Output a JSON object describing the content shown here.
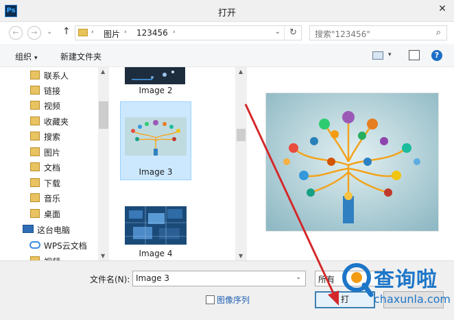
{
  "window": {
    "app_icon_label": "Ps",
    "title": "打开",
    "close_glyph": "✕"
  },
  "navigation": {
    "back_glyph": "←",
    "forward_glyph": "→",
    "history_glyph": "⌄",
    "up_glyph": "↑",
    "breadcrumb": [
      "图片",
      "123456"
    ],
    "breadcrumb_separator": "›",
    "dropdown_glyph": "⌄",
    "refresh_glyph": "↻",
    "search_placeholder": "搜索\"123456\"",
    "search_glyph": "⌕"
  },
  "toolbar": {
    "organize_label": "组织",
    "organize_caret": "▾",
    "new_folder_label": "新建文件夹",
    "view_caret": "▾",
    "help_glyph": "?"
  },
  "sidebar": {
    "items": [
      {
        "label": "联系人",
        "icon": "contacts-folder-icon"
      },
      {
        "label": "链接",
        "icon": "links-folder-icon"
      },
      {
        "label": "视频",
        "icon": "videos-folder-icon"
      },
      {
        "label": "收藏夹",
        "icon": "favorites-folder-icon"
      },
      {
        "label": "搜索",
        "icon": "searches-folder-icon"
      },
      {
        "label": "图片",
        "icon": "pictures-folder-icon"
      },
      {
        "label": "文档",
        "icon": "documents-folder-icon"
      },
      {
        "label": "下载",
        "icon": "downloads-folder-icon"
      },
      {
        "label": "音乐",
        "icon": "music-folder-icon"
      },
      {
        "label": "桌面",
        "icon": "desktop-folder-icon"
      },
      {
        "label": "这台电脑",
        "icon": "computer-icon"
      },
      {
        "label": "WPS云文档",
        "icon": "wps-cloud-icon"
      },
      {
        "label": "视频",
        "icon": "videos-folder-icon"
      }
    ]
  },
  "files": {
    "items": [
      {
        "name": "Image 2",
        "selected": false
      },
      {
        "name": "Image 3",
        "selected": true
      },
      {
        "name": "Image 4",
        "selected": false
      }
    ]
  },
  "bottom": {
    "filename_label": "文件名(N):",
    "filename_value": "Image 3",
    "filename_caret": "⌄",
    "filetype_value": "所有",
    "image_sequence_label": "图像序列",
    "open_button_label": "打"
  },
  "watermark": {
    "text": "查询啦",
    "url": "chaxunla.com"
  },
  "colors": {
    "accent": "#1d76c8",
    "selection": "#cce8ff",
    "annotation_arrow": "#d4282b"
  }
}
